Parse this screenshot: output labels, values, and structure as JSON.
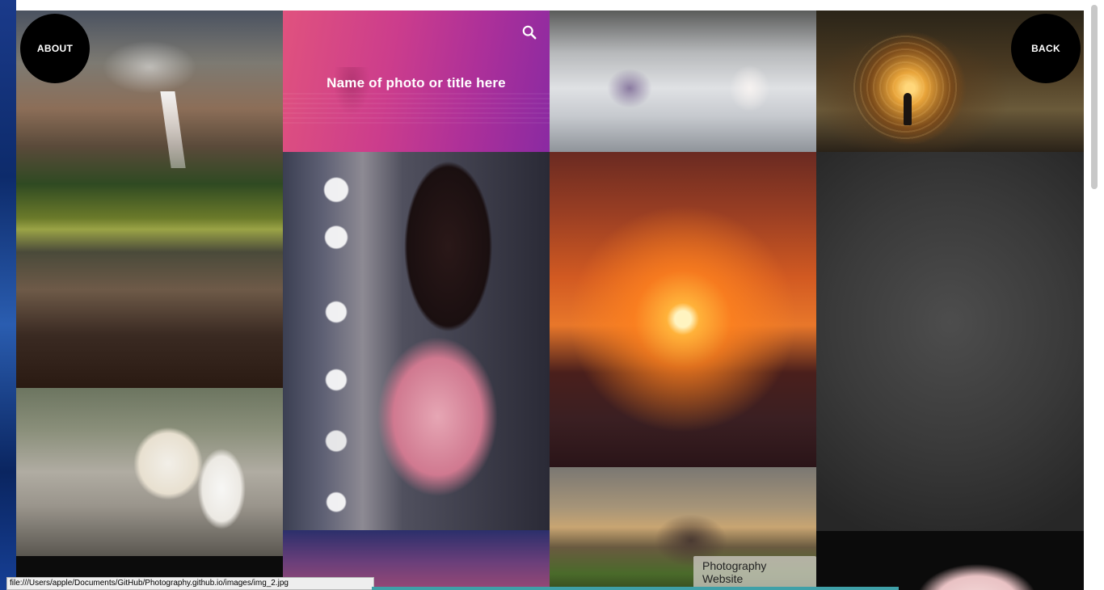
{
  "nav": {
    "about_label": "ABOUT",
    "back_label": "BACK"
  },
  "gallery": {
    "featured_title": "Name of photo or title here",
    "caption": "Photography Website"
  },
  "icons": {
    "search": "search-icon"
  },
  "status_bar": {
    "url": "file:///Users/apple/Documents/GitHub/Photography.github.io/images/img_2.jpg"
  },
  "colors": {
    "circle_bg": "#000000",
    "title_gradient_start": "#e0527e",
    "title_gradient_end": "#8a2aa2",
    "progress_bar": "#3fa0a8"
  }
}
